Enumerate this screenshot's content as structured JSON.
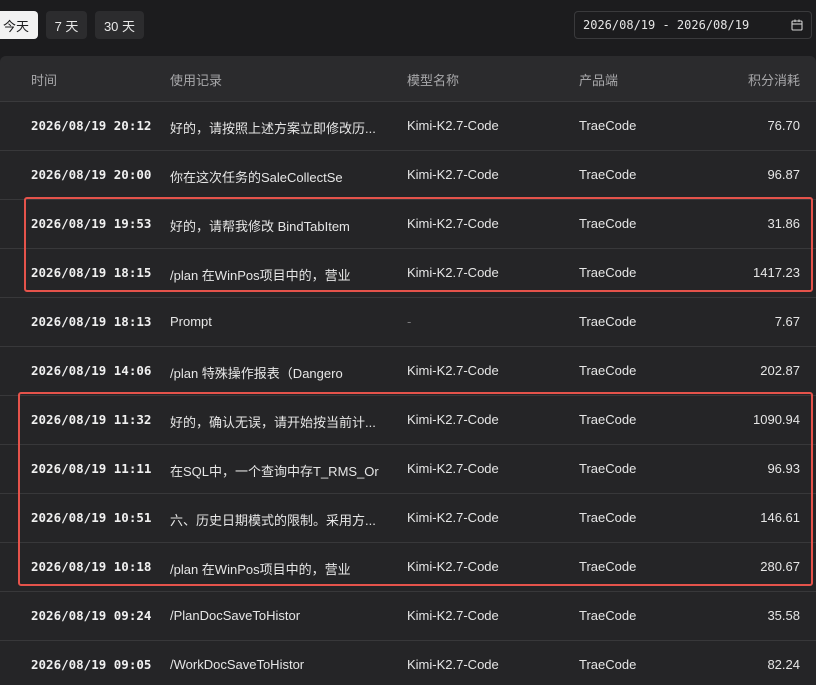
{
  "filters": {
    "today_label": "今天",
    "seven_days_label": "7 天",
    "thirty_days_label": "30 天",
    "date_range": "2026/08/19 - 2026/08/19",
    "calendar_icon": "calendar-icon"
  },
  "table": {
    "headers": {
      "time": "时间",
      "record": "使用记录",
      "model": "模型名称",
      "product": "产品端",
      "points": "积分消耗"
    },
    "rows": [
      {
        "time": "2026/08/19 20:12",
        "record": "好的，请按照上述方案立即修改历...",
        "model": "Kimi-K2.7-Code",
        "product": "TraeCode",
        "points": "76.70"
      },
      {
        "time": "2026/08/19 20:00",
        "record": "你在这次任务的SaleCollectSe",
        "model": "Kimi-K2.7-Code",
        "product": "TraeCode",
        "points": "96.87"
      },
      {
        "time": "2026/08/19 19:53",
        "record": "好的，请帮我修改 BindTabItem",
        "model": "Kimi-K2.7-Code",
        "product": "TraeCode",
        "points": "31.86"
      },
      {
        "time": "2026/08/19 18:15",
        "record": "/plan 在WinPos项目中的，营业",
        "model": "Kimi-K2.7-Code",
        "product": "TraeCode",
        "points": "1417.23"
      },
      {
        "time": "2026/08/19 18:13",
        "record": "Prompt",
        "model": "-",
        "product": "TraeCode",
        "points": "7.67"
      },
      {
        "time": "2026/08/19 14:06",
        "record": "/plan 特殊操作报表（Dangero",
        "model": "Kimi-K2.7-Code",
        "product": "TraeCode",
        "points": "202.87"
      },
      {
        "time": "2026/08/19 11:32",
        "record": "好的，确认无误，请开始按当前计...",
        "model": "Kimi-K2.7-Code",
        "product": "TraeCode",
        "points": "1090.94"
      },
      {
        "time": "2026/08/19 11:11",
        "record": "在SQL中，一个查询中存T_RMS_Or",
        "model": "Kimi-K2.7-Code",
        "product": "TraeCode",
        "points": "96.93"
      },
      {
        "time": "2026/08/19 10:51",
        "record": "六、历史日期模式的限制。采用方...",
        "model": "Kimi-K2.7-Code",
        "product": "TraeCode",
        "points": "146.61"
      },
      {
        "time": "2026/08/19 10:18",
        "record": "/plan 在WinPos项目中的，营业",
        "model": "Kimi-K2.7-Code",
        "product": "TraeCode",
        "points": "280.67"
      },
      {
        "time": "2026/08/19 09:24",
        "record": "/PlanDocSaveToHistor",
        "model": "Kimi-K2.7-Code",
        "product": "TraeCode",
        "points": "35.58"
      },
      {
        "time": "2026/08/19 09:05",
        "record": "/WorkDocSaveToHistor",
        "model": "Kimi-K2.7-Code",
        "product": "TraeCode",
        "points": "82.24"
      }
    ]
  },
  "colors": {
    "background": "#1c1c1e",
    "table_bg": "#252527",
    "highlight": "#e5534b"
  }
}
